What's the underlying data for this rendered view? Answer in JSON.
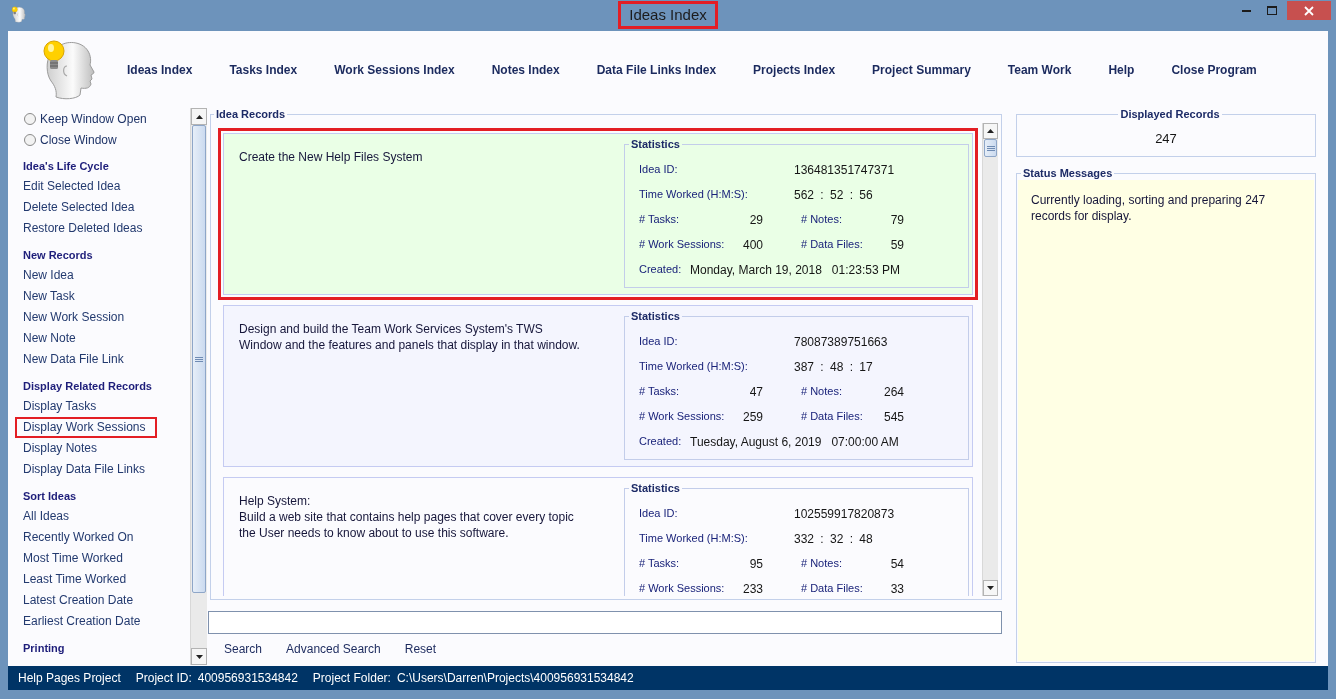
{
  "window": {
    "title": "Ideas Index",
    "title_highlighted": true
  },
  "menu": [
    {
      "label": "Ideas Index"
    },
    {
      "label": "Tasks Index"
    },
    {
      "label": "Work Sessions Index"
    },
    {
      "label": "Notes Index"
    },
    {
      "label": "Data File Links Index"
    },
    {
      "label": "Projects Index"
    },
    {
      "label": "Project Summary"
    },
    {
      "label": "Team Work"
    },
    {
      "label": "Help"
    },
    {
      "label": "Close Program"
    }
  ],
  "sidebar": {
    "window_options": [
      {
        "label": "Keep Window Open",
        "selected": false
      },
      {
        "label": "Close Window",
        "selected": false
      }
    ],
    "sections": [
      {
        "title": "Idea's Life Cycle",
        "items": [
          {
            "label": "Edit Selected Idea",
            "highlighted": false
          },
          {
            "label": "Delete Selected Idea",
            "highlighted": false
          },
          {
            "label": "Restore Deleted Ideas",
            "highlighted": false
          }
        ]
      },
      {
        "title": "New Records",
        "items": [
          {
            "label": "New Idea",
            "highlighted": false
          },
          {
            "label": "New Task",
            "highlighted": false
          },
          {
            "label": "New Work Session",
            "highlighted": false
          },
          {
            "label": "New Note",
            "highlighted": false
          },
          {
            "label": "New Data File Link",
            "highlighted": false
          }
        ]
      },
      {
        "title": "Display Related Records",
        "items": [
          {
            "label": "Display Tasks",
            "highlighted": false
          },
          {
            "label": "Display Work Sessions",
            "highlighted": true
          },
          {
            "label": "Display Notes",
            "highlighted": false
          },
          {
            "label": "Display Data File Links",
            "highlighted": false
          }
        ]
      },
      {
        "title": "Sort Ideas",
        "items": [
          {
            "label": "All Ideas",
            "highlighted": false
          },
          {
            "label": "Recently Worked On",
            "highlighted": false
          },
          {
            "label": "Most Time Worked",
            "highlighted": false
          },
          {
            "label": "Least Time Worked",
            "highlighted": false
          },
          {
            "label": "Latest Creation Date",
            "highlighted": false
          },
          {
            "label": "Earliest Creation Date",
            "highlighted": false
          }
        ]
      },
      {
        "title": "Printing"
      }
    ]
  },
  "idea_records": {
    "title": "Idea Records",
    "records": [
      {
        "text": "Create the New Help Files System",
        "selected": true,
        "highlighted": true,
        "statistics": {
          "title": "Statistics",
          "rows": [
            {
              "kind": "field",
              "label": "Idea ID:",
              "value": "136481351747371"
            },
            {
              "kind": "field",
              "label": "Time Worked (H:M:S):",
              "value": "562 : 52 : 56"
            },
            {
              "kind": "pair",
              "cells": [
                {
                  "label": "# Tasks:",
                  "value": "29"
                },
                {
                  "label": "# Notes:",
                  "value": "79"
                }
              ]
            },
            {
              "kind": "pair",
              "cells": [
                {
                  "label": "# Work Sessions:",
                  "value": "400"
                },
                {
                  "label": "# Data Files:",
                  "value": "59"
                }
              ]
            },
            {
              "kind": "created",
              "label": "Created:",
              "date": "Monday, March 19, 2018",
              "time": "01:23:53 PM"
            }
          ]
        }
      },
      {
        "text": "Design and build the Team Work Services System's TWS\nWindow and the features and panels that display in that window.",
        "selected": false,
        "highlighted": false,
        "statistics": {
          "title": "Statistics",
          "rows": [
            {
              "kind": "field",
              "label": "Idea ID:",
              "value": "78087389751663"
            },
            {
              "kind": "field",
              "label": "Time Worked (H:M:S):",
              "value": "387 : 48 : 17"
            },
            {
              "kind": "pair",
              "cells": [
                {
                  "label": "# Tasks:",
                  "value": "47"
                },
                {
                  "label": "# Notes:",
                  "value": "264"
                }
              ]
            },
            {
              "kind": "pair",
              "cells": [
                {
                  "label": "# Work Sessions:",
                  "value": "259"
                },
                {
                  "label": "# Data Files:",
                  "value": "545"
                }
              ]
            },
            {
              "kind": "created",
              "label": "Created:",
              "date": "Tuesday, August 6, 2019",
              "time": "07:00:00 AM"
            }
          ]
        }
      },
      {
        "text": "Help System:\nBuild a web site that contains help pages that cover every topic\nthe User needs to know about to use this software.",
        "selected": false,
        "highlighted": false,
        "statistics": {
          "title": "Statistics",
          "rows": [
            {
              "kind": "field",
              "label": "Idea ID:",
              "value": "102559917820873"
            },
            {
              "kind": "field",
              "label": "Time Worked (H:M:S):",
              "value": "332 : 32 : 48"
            },
            {
              "kind": "pair",
              "cells": [
                {
                  "label": "# Tasks:",
                  "value": "95"
                },
                {
                  "label": "# Notes:",
                  "value": "54"
                }
              ]
            },
            {
              "kind": "pair",
              "cells": [
                {
                  "label": "# Work Sessions:",
                  "value": "233"
                },
                {
                  "label": "# Data Files:",
                  "value": "33"
                }
              ]
            }
          ]
        }
      }
    ]
  },
  "search": {
    "buttons": [
      {
        "label": "Search"
      },
      {
        "label": "Advanced Search"
      },
      {
        "label": "Reset"
      }
    ]
  },
  "displayed_records": {
    "title": "Displayed Records",
    "value": "247"
  },
  "status_messages": {
    "title": "Status Messages",
    "text": "Currently loading, sorting and preparing 247 records for display."
  },
  "status_bar": {
    "items": [
      {
        "label": "Help Pages Project"
      },
      {
        "label": "Project ID:",
        "value": "400956931534842"
      },
      {
        "label": "Project Folder:",
        "value": "C:\\Users\\Darren\\Projects\\400956931534842"
      }
    ]
  }
}
